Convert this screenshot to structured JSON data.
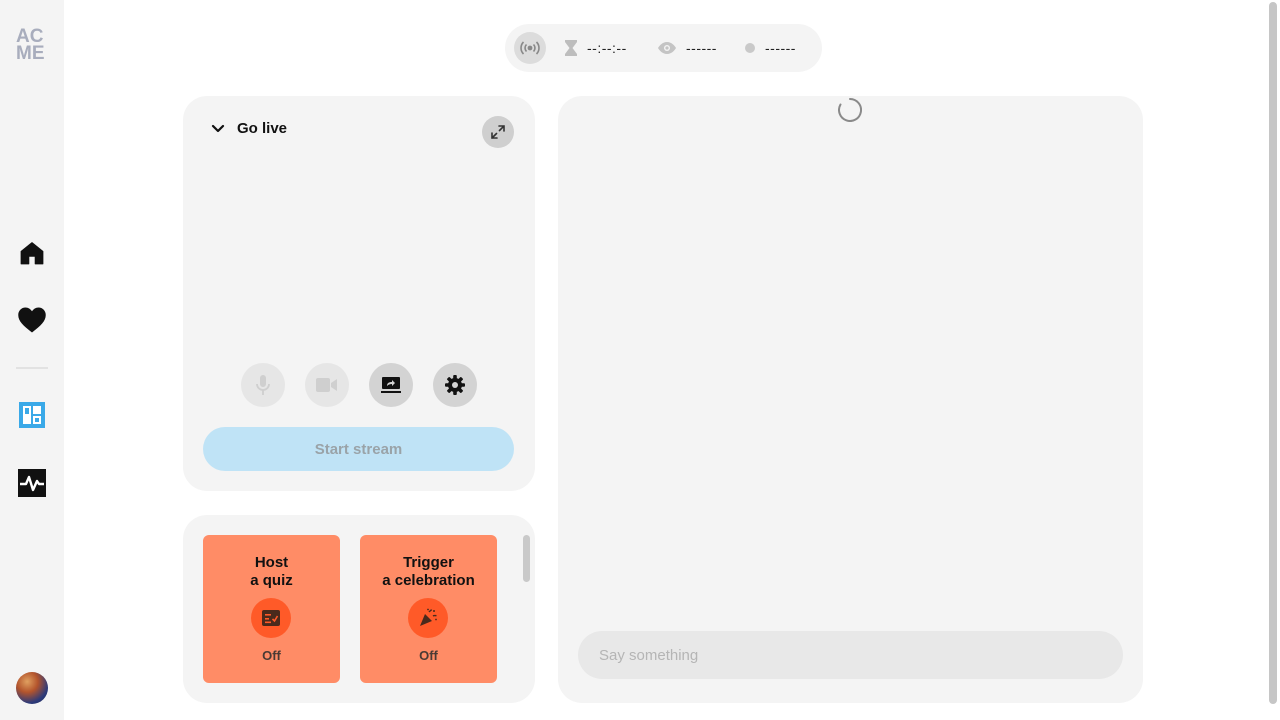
{
  "brand": {
    "logo_line1": "AC",
    "logo_line2": "ME"
  },
  "sidebar": {
    "items": [
      {
        "icon": "home-icon"
      },
      {
        "icon": "heart-icon"
      },
      {
        "icon": "dashboard-icon",
        "color": "#3aa9e8"
      },
      {
        "icon": "activity-icon"
      }
    ]
  },
  "stats": {
    "timer": "--:--:--",
    "viewers": "------",
    "status": "------"
  },
  "golive": {
    "title": "Go live",
    "controls": [
      {
        "icon": "microphone-icon",
        "state": "disabled"
      },
      {
        "icon": "camera-icon",
        "state": "disabled"
      },
      {
        "icon": "screen-share-icon",
        "state": "active"
      },
      {
        "icon": "gear-icon",
        "state": "active"
      }
    ],
    "start_label": "Start stream",
    "start_color": "#bfe3f6"
  },
  "actions": {
    "cards": [
      {
        "title_line1": "Host",
        "title_line2": "a quiz",
        "icon": "quiz-icon",
        "status": "Off"
      },
      {
        "title_line1": "Trigger",
        "title_line2": "a celebration",
        "icon": "party-popper-icon",
        "status": "Off"
      }
    ],
    "card_color": "#ff8c66",
    "icon_bg": "#ff5a28"
  },
  "chat": {
    "placeholder": "Say something"
  }
}
